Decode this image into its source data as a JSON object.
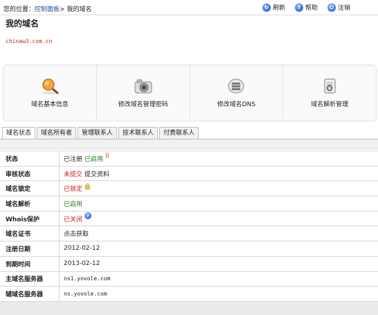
{
  "breadcrumb": {
    "prefix": "您的位置：",
    "link": "控制面板",
    "sep": ">",
    "current": "我的域名"
  },
  "toolbar": [
    {
      "label": "刷新",
      "icon": "refresh-icon",
      "glyph": "↻"
    },
    {
      "label": "帮助",
      "icon": "help-icon",
      "glyph": "?"
    },
    {
      "label": "注销",
      "icon": "logout-icon",
      "glyph": "⏻"
    }
  ],
  "page_title": "我的域名",
  "domain_name": "chinaw3.com.cn",
  "actions": [
    {
      "label": "域名基本信息",
      "icon": "magnifier-icon"
    },
    {
      "label": "修改域名管理密码",
      "icon": "camera-icon"
    },
    {
      "label": "修改域名DNS",
      "icon": "server-icon"
    },
    {
      "label": "域名解析管理",
      "icon": "document-gear-icon"
    }
  ],
  "tabs": [
    "域名状态",
    "域名所有者",
    "管理联系人",
    "技术联系人",
    "付费联系人"
  ],
  "active_tab": "域名状态",
  "rows": {
    "status": {
      "key": "状态",
      "a": "已注册",
      "b": "已启用",
      "mark": "||"
    },
    "audit": {
      "key": "审核状态",
      "a": "未提交",
      "b": "提交资料"
    },
    "lock": {
      "key": "域名锁定",
      "a": "已锁定"
    },
    "resolve": {
      "key": "域名解析",
      "a": "已启用"
    },
    "whois": {
      "key": "Whois保护",
      "a": "已关闭",
      "help": "?"
    },
    "cert": {
      "key": "域名证书",
      "a": "点击获取"
    },
    "reg_date": {
      "key": "注册日期",
      "a": "2012-02-12"
    },
    "expire_date": {
      "key": "到期时间",
      "a": "2013-02-12"
    },
    "ns1": {
      "key": "主域名服务器",
      "a": "ns1.yovole.com"
    },
    "ns2": {
      "key": "辅域名服务器",
      "a": "ns.yovole.com"
    }
  },
  "colors": {
    "green": "#1a7f1a",
    "red": "#c0251f",
    "link": "#1f4f9c"
  }
}
